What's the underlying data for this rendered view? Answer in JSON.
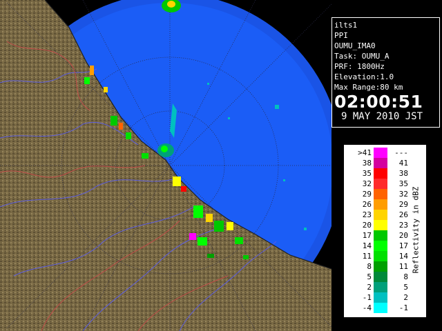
{
  "radar": {
    "colors": {
      "sea": "#1b5df6",
      "range_ring": "#1c63ff",
      "outer": "#000000",
      "land": "#7a6a45",
      "river": "#5b5de0",
      "boundary": "#c04b48",
      "coast": "#202020"
    }
  },
  "info": {
    "station": "ilts1",
    "product": "PPI",
    "site": "OUMU_IMA0",
    "task": "Task: OUMU_A",
    "prf": "PRF: 1800Hz",
    "elevation": "Elevation:1.0",
    "max_range": "Max Range:80 km",
    "time": "02:00:51",
    "date": "9 MAY 2010 JST"
  },
  "legend": {
    "title": "Reflectivity in dBZ",
    "rows": [
      {
        "lo": ">41",
        "hi": "---",
        "color": "#ff00ff"
      },
      {
        "lo": "38",
        "hi": "41",
        "color": "#d4009f"
      },
      {
        "lo": "35",
        "hi": "38",
        "color": "#ff0000"
      },
      {
        "lo": "32",
        "hi": "35",
        "color": "#ff2a2a"
      },
      {
        "lo": "29",
        "hi": "32",
        "color": "#ff6200"
      },
      {
        "lo": "26",
        "hi": "29",
        "color": "#ff9d00"
      },
      {
        "lo": "23",
        "hi": "26",
        "color": "#ffd400"
      },
      {
        "lo": "20",
        "hi": "23",
        "color": "#ffff00"
      },
      {
        "lo": "17",
        "hi": "20",
        "color": "#00c800"
      },
      {
        "lo": "14",
        "hi": "17",
        "color": "#00ff00"
      },
      {
        "lo": "11",
        "hi": "14",
        "color": "#00e000"
      },
      {
        "lo": "8",
        "hi": "11",
        "color": "#00a000"
      },
      {
        "lo": "5",
        "hi": "8",
        "color": "#008a3a"
      },
      {
        "lo": "2",
        "hi": "5",
        "color": "#00a07a"
      },
      {
        "lo": "-1",
        "hi": "2",
        "color": "#00c0c0"
      },
      {
        "lo": "-4",
        "hi": "-1",
        "color": "#00ffff"
      }
    ]
  }
}
